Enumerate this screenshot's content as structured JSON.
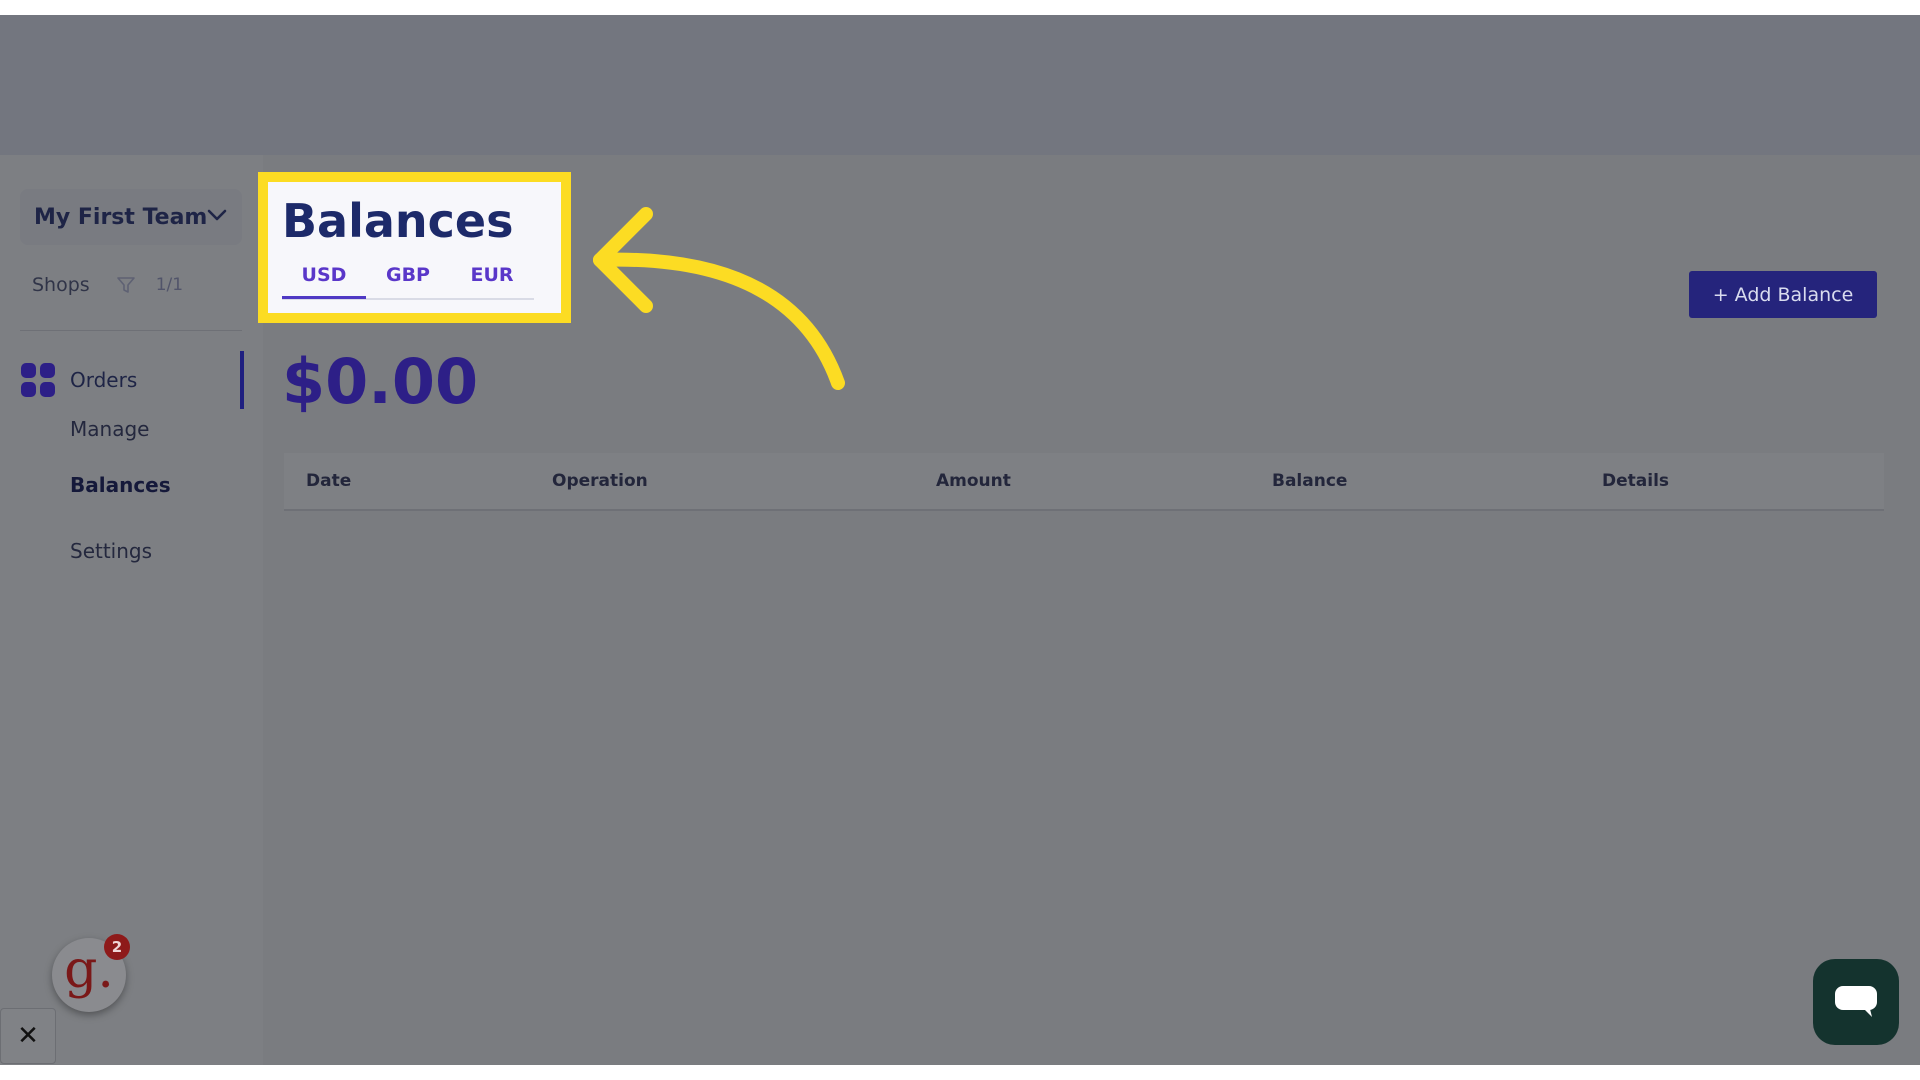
{
  "sidebar": {
    "team_name": "My First Team",
    "shops_label": "Shops",
    "shops_count": "1/1",
    "nav": {
      "orders": "Orders",
      "manage": "Manage",
      "balances": "Balances",
      "settings": "Settings"
    }
  },
  "main": {
    "title": "Balances",
    "tabs": [
      {
        "label": "USD",
        "active": true
      },
      {
        "label": "GBP",
        "active": false
      },
      {
        "label": "EUR",
        "active": false
      }
    ],
    "add_button": "+ Add Balance",
    "amount": "$0.00",
    "table_headers": [
      "Date",
      "Operation",
      "Amount",
      "Balance",
      "Details"
    ]
  },
  "overlay": {
    "guide_letter": "g.",
    "badge_count": "2",
    "close_symbol": "✕"
  },
  "colors": {
    "accent": "#2d1f87",
    "highlight": "#fcdc23",
    "button": "#25247c"
  },
  "icons": [
    "chevron-down-icon",
    "filter-icon",
    "grid-icon",
    "close-icon",
    "chat-icon",
    "arrow-annotation"
  ]
}
